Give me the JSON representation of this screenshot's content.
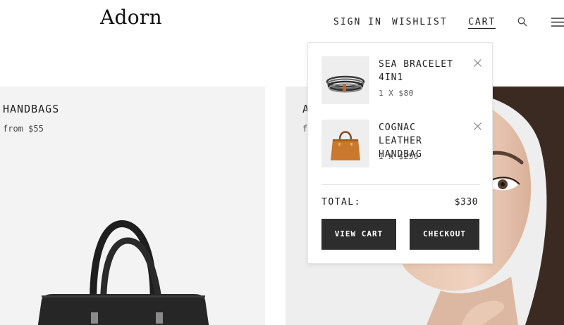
{
  "header": {
    "logo": "Adorn",
    "nav": {
      "sign_in": "SIGN IN",
      "wishlist": "WISHLIST",
      "cart": "CART"
    },
    "icons": [
      "search-icon",
      "menu-icon"
    ]
  },
  "categories": [
    {
      "title": "HANDBAGS",
      "subtitle": "from $55"
    },
    {
      "title": "A",
      "subtitle": "f"
    }
  ],
  "cart": {
    "items": [
      {
        "name": "SEA BRACELET 4IN1",
        "qty_price": "1 X $80"
      },
      {
        "name": "COGNAC LEATHER HANDBAG",
        "qty_price": "1 X $250"
      }
    ],
    "total_label": "TOTAL:",
    "total_value": "$330",
    "view_cart_label": "VIEW CART",
    "checkout_label": "CHECKOUT"
  },
  "colors": {
    "button_bg": "#2d2d2d",
    "panel_bg": "#f3f3f3",
    "text": "#222222"
  }
}
